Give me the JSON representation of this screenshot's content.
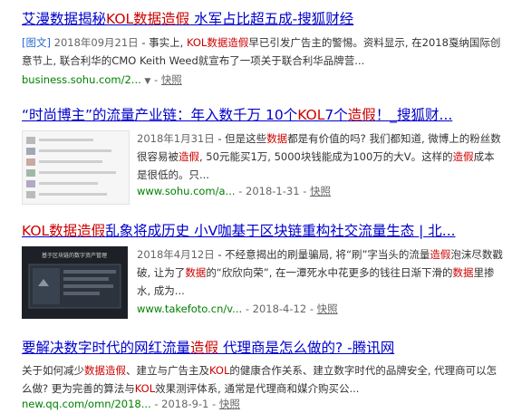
{
  "results": [
    {
      "title_parts": [
        {
          "t": "艾漫数据揭秘",
          "hl": false
        },
        {
          "t": "KOL数据造假",
          "hl": true
        },
        {
          "t": " 水军占比超五成-搜狐财经",
          "hl": false
        }
      ],
      "tag": "[图文]",
      "date": "2018年09月21日",
      "abstract_parts": [
        {
          "t": " - 事实上, ",
          "hl": false
        },
        {
          "t": "KOL数据造假",
          "hl": true
        },
        {
          "t": "早已引发广告主的警惕。资料显示, 在2018戛纳国际创意节上, 联合利华的CMO Keith Weed就宣布了一项关于联合利华品牌营...",
          "hl": false
        }
      ],
      "url": "business.sohu.com/2...",
      "snapshot": "快照"
    },
    {
      "title_parts": [
        {
          "t": "“时尚博主”的流量产业链：年入数千万 10个",
          "hl": false
        },
        {
          "t": "KOL",
          "hl": true
        },
        {
          "t": "7个",
          "hl": false
        },
        {
          "t": "造假",
          "hl": true
        },
        {
          "t": "！_搜狐财...",
          "hl": false
        }
      ],
      "date": "2018年1月31日",
      "abstract_parts": [
        {
          "t": " - 但是这些",
          "hl": false
        },
        {
          "t": "数据",
          "hl": true
        },
        {
          "t": "都是有价值的吗? 我们都知道, 微博上的粉丝数很容易被",
          "hl": false
        },
        {
          "t": "造假",
          "hl": true
        },
        {
          "t": ", 50元能买1万, 5000块钱能成为100万的大V。这样的",
          "hl": false
        },
        {
          "t": "造假",
          "hl": true
        },
        {
          "t": "成本是很低的。只...",
          "hl": false
        }
      ],
      "url": "www.sohu.com/a...",
      "date_short": "2018-1-31",
      "snapshot": "快照"
    },
    {
      "title_parts": [
        {
          "t": "KOL数据造假",
          "hl": true
        },
        {
          "t": "乱象将成历史 小V咖基于区块链重构社交流量生态 | 北...",
          "hl": false
        }
      ],
      "date": "2018年4月12日",
      "abstract_parts": [
        {
          "t": " - 不经意揭出的刷量骗局, 将“刷”字当头的流量",
          "hl": false
        },
        {
          "t": "造假",
          "hl": true
        },
        {
          "t": "泡沫尽数戳破, 让为了",
          "hl": false
        },
        {
          "t": "数据",
          "hl": true
        },
        {
          "t": "的“欣欣向荣”, 在一潭死水中花更多的钱往日渐下滑的",
          "hl": false
        },
        {
          "t": "数据",
          "hl": true
        },
        {
          "t": "里掺水, 成为...",
          "hl": false
        }
      ],
      "url": "www.takefoto.cn/v...",
      "date_short": "2018-4-12",
      "snapshot": "快照",
      "thumb_caption": "基于区块链的数字资产管理"
    },
    {
      "title_parts": [
        {
          "t": "要解决数字时代的网红流量",
          "hl": false
        },
        {
          "t": "造假",
          "hl": true
        },
        {
          "t": " 代理商是怎么做的? -腾讯网",
          "hl": false
        }
      ],
      "abstract_parts": [
        {
          "t": "关于如何减少",
          "hl": false
        },
        {
          "t": "数据造假",
          "hl": true
        },
        {
          "t": "、建立与广告主及",
          "hl": false
        },
        {
          "t": "KOL",
          "hl": true
        },
        {
          "t": "的健康合作关系、建立数字时代的品牌安全, 代理商可以怎么做? 更为完善的算法与",
          "hl": false
        },
        {
          "t": "KOL",
          "hl": true
        },
        {
          "t": "效果测评体系, 通常是代理商和媒介购买公...",
          "hl": false
        }
      ],
      "url": "new.qq.com/omn/2018...",
      "date_short": "2018-9-1",
      "snapshot": "快照"
    }
  ],
  "colors": {
    "link": "#0000cc",
    "highlight": "#cc0000",
    "url": "#008000",
    "text": "#333333"
  }
}
